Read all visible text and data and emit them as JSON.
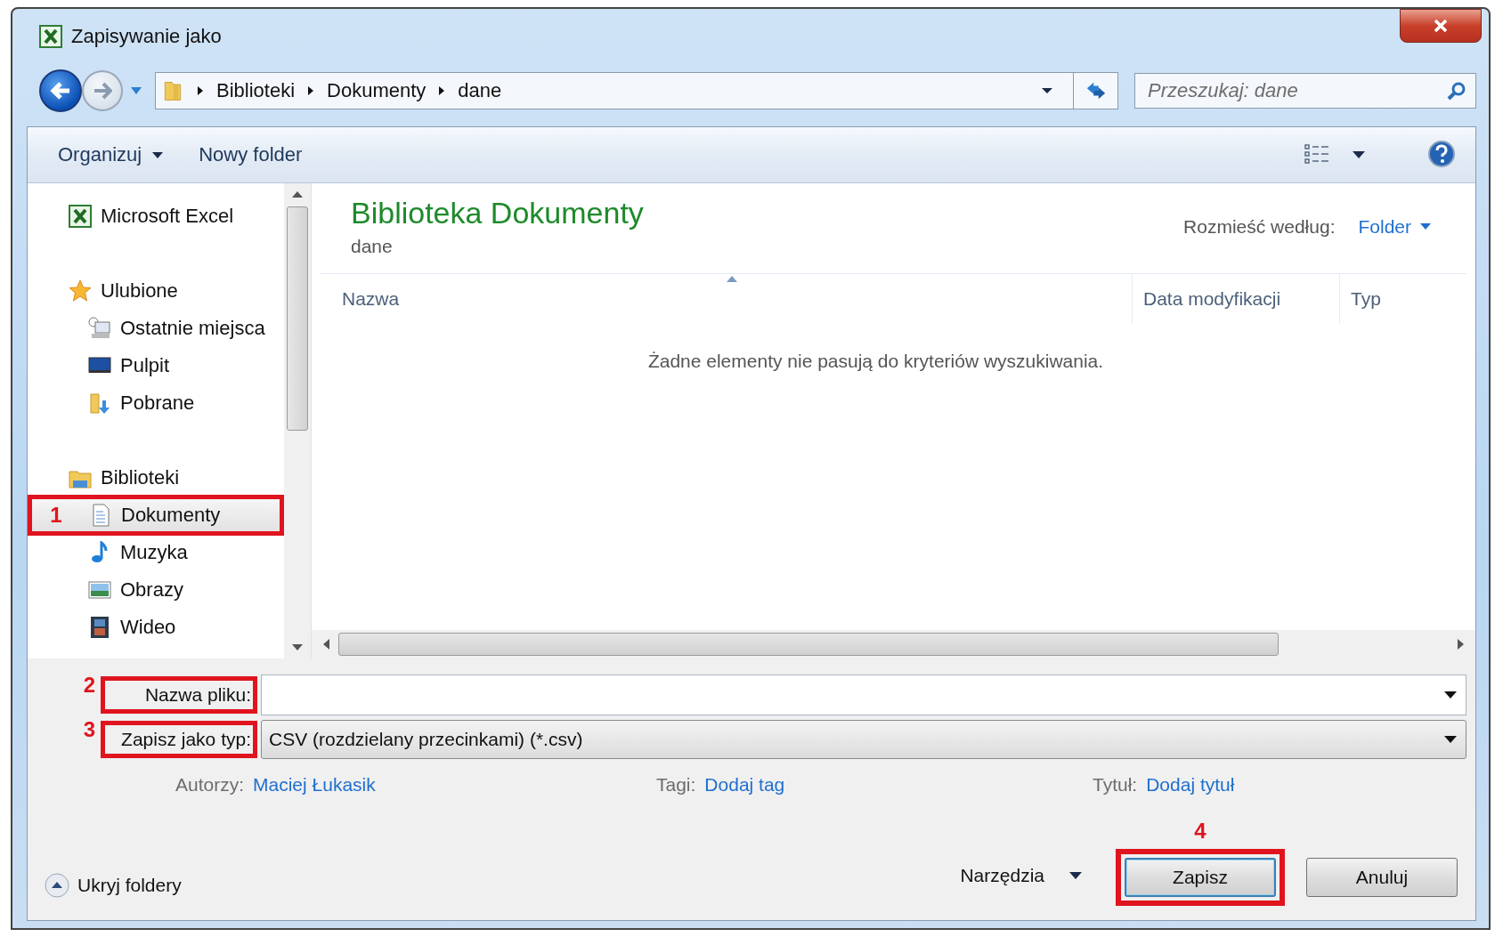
{
  "window": {
    "title": "Zapisywanie jako"
  },
  "address_bar": {
    "path": [
      "Biblioteki",
      "Dokumenty",
      "dane"
    ]
  },
  "search": {
    "placeholder": "Przeszukaj: dane"
  },
  "toolbar": {
    "buttons": [
      {
        "label": "Organizuj",
        "dropdown": true
      },
      {
        "label": "Nowy folder",
        "dropdown": false
      }
    ]
  },
  "sidebar": {
    "groups": [
      {
        "label": "Microsoft Excel",
        "selected": false
      },
      {
        "label": "Ulubione",
        "selected": false,
        "children": [
          {
            "label": "Ostatnie miejsca",
            "selected": false
          },
          {
            "label": "Pulpit",
            "selected": false
          },
          {
            "label": "Pobrane",
            "selected": false
          }
        ]
      },
      {
        "label": "Biblioteki",
        "selected": false,
        "children": [
          {
            "label": "Dokumenty",
            "selected": true,
            "annotation": "1"
          },
          {
            "label": "Muzyka",
            "selected": false
          },
          {
            "label": "Obrazy",
            "selected": false
          },
          {
            "label": "Wideo",
            "selected": false
          }
        ]
      }
    ]
  },
  "library": {
    "title": "Biblioteka Dokumenty",
    "subtitle": "dane",
    "arrange_label": "Rozmieść według:",
    "arrange_value": "Folder"
  },
  "table": {
    "columns": [
      {
        "label": "Nazwa",
        "sorted": true
      },
      {
        "label": "Data modyfikacji",
        "sorted": false
      },
      {
        "label": "Typ",
        "sorted": false
      }
    ],
    "empty_message": "Żadne elementy nie pasują do kryteriów wyszukiwania."
  },
  "form": {
    "file_name": {
      "label": "Nazwa pliku:",
      "annotation": "2"
    },
    "file_type": {
      "label": "Zapisz jako typ:",
      "value": "CSV (rozdzielany przecinkami) (*.csv)",
      "annotation": "3"
    }
  },
  "metadata": [
    {
      "label": "Autorzy:",
      "value": "Maciej Łukasik"
    },
    {
      "label": "Tagi:",
      "value": "Dodaj tag"
    },
    {
      "label": "Tytuł:",
      "value": "Dodaj tytuł"
    }
  ],
  "footer": {
    "hide_folders": "Ukryj foldery",
    "tools": "Narzędzia",
    "buttons": [
      {
        "label": "Zapisz",
        "default": true,
        "annotation": "4"
      },
      {
        "label": "Anuluj",
        "default": false
      }
    ]
  }
}
